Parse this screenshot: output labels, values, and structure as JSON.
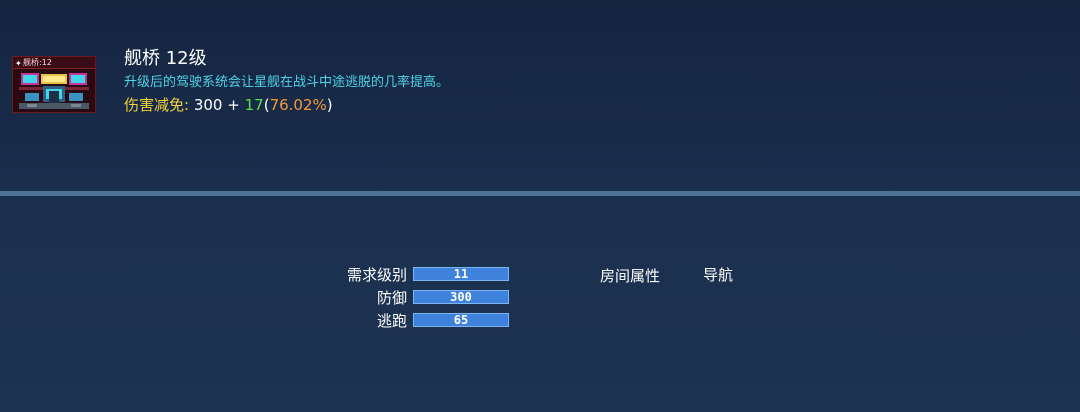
{
  "room": {
    "icon_name": "bridge-room-icon",
    "icon_label": "舰桥:12",
    "title": "舰桥 12级",
    "description": "升级后的驾驶系统会让星舰在战斗中途逃脱的几率提高。",
    "damage_reduction": {
      "label": "伤害减免:",
      "base": "300",
      "plus": "+",
      "bonus": "17",
      "open_paren": "(",
      "percent": "76.02%",
      "close_paren": ")"
    }
  },
  "stats": [
    {
      "label": "需求级别",
      "value": "11"
    },
    {
      "label": "防御",
      "value": "300"
    },
    {
      "label": "逃跑",
      "value": "65"
    }
  ],
  "property": {
    "label": "房间属性",
    "value": "导航"
  },
  "colors": {
    "background": "#192c48",
    "divider": "#4f7393",
    "description": "#4fd3e6",
    "damage_label": "#f2d33b",
    "bonus": "#5fdc43",
    "percent": "#f39a3c",
    "stat_bar": "#3f82dc"
  }
}
